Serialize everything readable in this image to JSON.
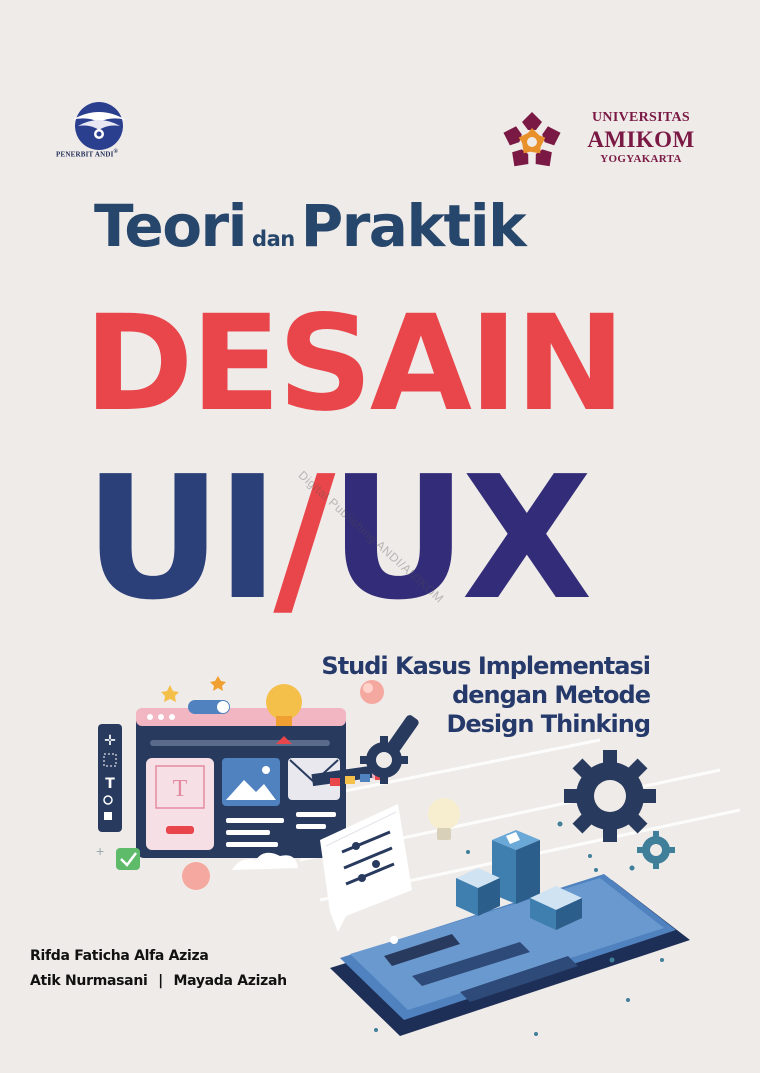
{
  "publisher": {
    "name": "PENERBIT ANDI",
    "mark": "®"
  },
  "university": {
    "line1": "UNIVERSITAS",
    "line2": "AMIKOM",
    "line3": "YOGYAKARTA"
  },
  "title": {
    "part1": "Teori",
    "part2": "dan",
    "part3": "Praktik"
  },
  "headline": {
    "word1": "DESAIN",
    "ui": "UI",
    "slash": "/",
    "ux": "UX"
  },
  "watermark": "Digital Publishing ANDI/AMIKOM",
  "subtitle": {
    "line1": "Studi Kasus Implementasi",
    "line2": "dengan Metode",
    "line3": "Design Thinking"
  },
  "authors": {
    "line1": "Rifda Faticha Alfa Aziza",
    "line2_a": "Atik Nurmasani",
    "separator": "|",
    "line2_b": "Mayada Azizah"
  },
  "illustration": {
    "text_tool_glyph": "T",
    "colors": {
      "pink": "#f2b5c2",
      "navy": "#283a5e",
      "blue": "#4f82bf",
      "teal": "#3f7f9a",
      "yellow": "#f5c04a",
      "red": "#e8464b"
    }
  }
}
